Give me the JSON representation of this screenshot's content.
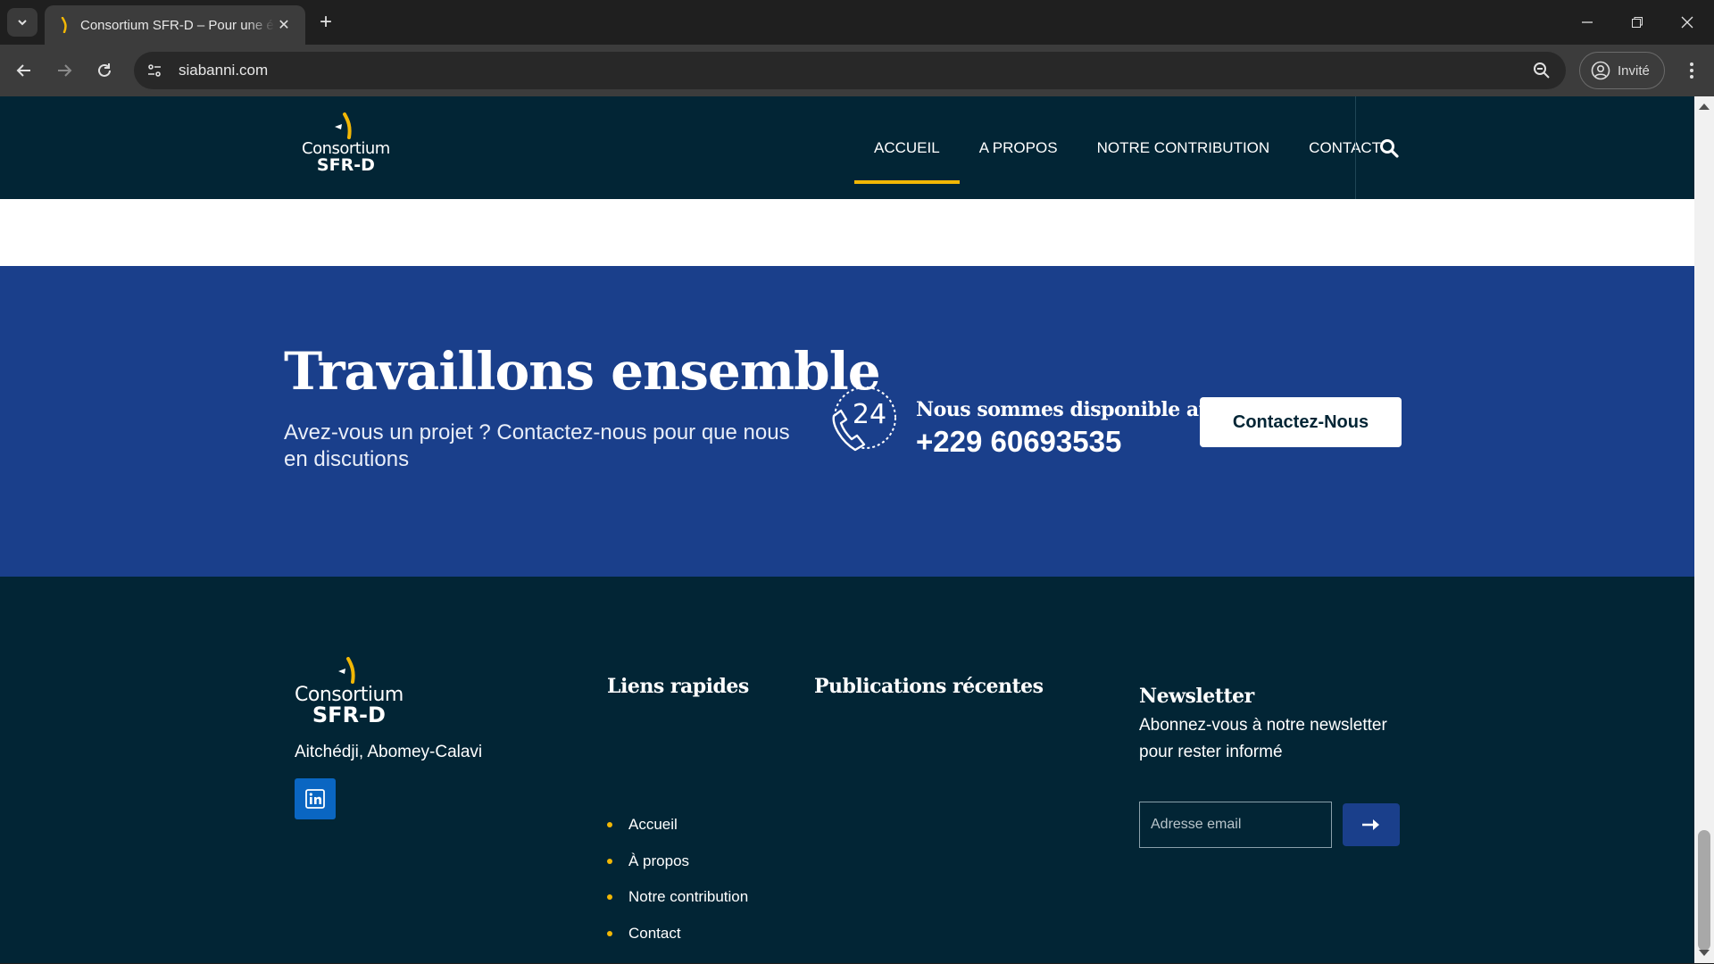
{
  "browser": {
    "tab_title": "Consortium SFR-D – Pour une é",
    "url": "siabanni.com",
    "profile_label": "Invité"
  },
  "header": {
    "logo": {
      "line1": "Consortium",
      "line2": "SFR-D"
    },
    "nav": [
      {
        "label": "ACCUEIL",
        "active": true
      },
      {
        "label": "A PROPOS",
        "active": false
      },
      {
        "label": "NOTRE CONTRIBUTION",
        "active": false
      },
      {
        "label": "CONTACT",
        "active": false
      }
    ]
  },
  "cta": {
    "title": "Travaillons ensemble",
    "text": "Avez-vous un projet ? Contactez-nous pour que nous en discutions",
    "phone_icon_label": "24",
    "availability": "Nous sommes disponible au",
    "phone": "+229 60693535",
    "button": "Contactez-Nous"
  },
  "footer": {
    "logo": {
      "line1": "Consortium",
      "line2": "SFR-D"
    },
    "address": "Aitchédji, Abomey-Calavi",
    "quick_links": {
      "title": "Liens rapides",
      "items": [
        "Accueil",
        "À propos",
        "Notre contribution",
        "Contact"
      ]
    },
    "recent_posts": {
      "title": "Publications récentes"
    },
    "newsletter": {
      "title": "Newsletter",
      "text": "Abonnez-vous à notre newsletter pour rester informé",
      "email_placeholder": "Adresse email"
    }
  },
  "colors": {
    "header_bg": "#022535",
    "cta_bg": "#1a3f8b",
    "accent": "#f2b705",
    "linkedin": "#0a66c2"
  },
  "icons": [
    "tab-search-icon",
    "back-icon",
    "forward-icon",
    "reload-icon",
    "site-info-icon",
    "zoom-icon",
    "profile-icon",
    "menu-icon",
    "search-icon",
    "phone-24-icon",
    "linkedin-icon",
    "arrow-right-icon"
  ]
}
